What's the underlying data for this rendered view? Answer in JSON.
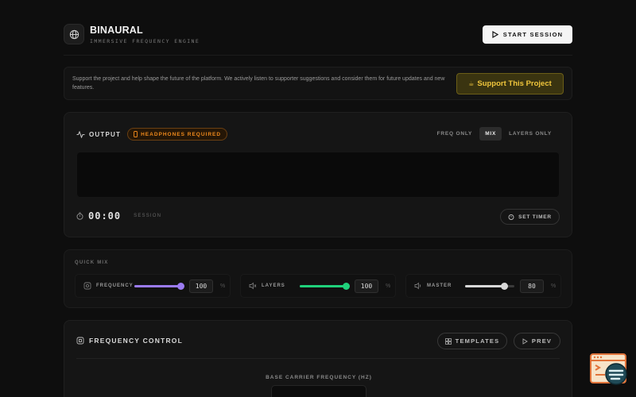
{
  "header": {
    "title": "BINAURAL",
    "subtitle": "IMMERSIVE FREQUENCY ENGINE",
    "start_button": "START SESSION"
  },
  "support": {
    "text": "Support the project and help shape the future of the platform. We actively listen to supporter suggestions and consider them for future updates and new features.",
    "button": "Support This Project",
    "button_icon": "☕"
  },
  "output": {
    "label": "OUTPUT",
    "badge": "HEADPHONES REQUIRED",
    "modes": [
      "FREQ ONLY",
      "MIX",
      "LAYERS ONLY"
    ],
    "active_mode": "MIX",
    "timer": "00:00",
    "timer_label": "SESSION",
    "set_timer": "SET TIMER"
  },
  "quick_mix": {
    "title": "QUICK MIX",
    "channels": [
      {
        "label": "FREQUENCY",
        "value": "100",
        "level": 1.0,
        "color": "#9b7bf2",
        "icon": "waveform-icon"
      },
      {
        "label": "LAYERS",
        "value": "100",
        "level": 1.0,
        "color": "#1fd17b",
        "icon": "speaker-icon"
      },
      {
        "label": "MASTER",
        "value": "80",
        "level": 0.8,
        "color": "#d8d8d8",
        "icon": "volume-icon"
      }
    ],
    "unit": "%"
  },
  "frequency_control": {
    "title": "FREQUENCY CONTROL",
    "templates_button": "TEMPLATES",
    "prev_button": "PREV",
    "carrier_label": "BASE CARRIER FREQUENCY (HZ)"
  },
  "colors": {
    "accent_gold": "#f0c63c",
    "warning_orange": "#f08a1c",
    "frequency_purple": "#9b7bf2",
    "layers_green": "#1fd17b"
  }
}
